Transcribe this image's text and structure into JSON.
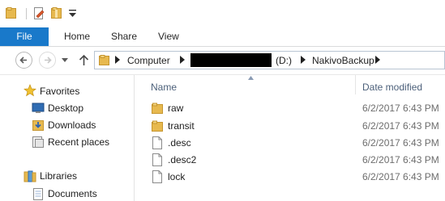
{
  "ribbon": {
    "tabs": [
      "File",
      "Home",
      "Share",
      "View"
    ]
  },
  "quick_access": {
    "icons": [
      "folder-icon",
      "properties-icon",
      "new-folder-icon",
      "customize-dropdown-icon"
    ]
  },
  "address_bar": {
    "segments": [
      "Computer",
      "(D:)",
      "NakivoBackup"
    ],
    "redacted": true
  },
  "nav_pane": {
    "favorites_label": "Favorites",
    "favorites": [
      "Desktop",
      "Downloads",
      "Recent places"
    ],
    "libraries_label": "Libraries",
    "libraries": [
      "Documents"
    ]
  },
  "file_list": {
    "columns": {
      "name": "Name",
      "date_modified": "Date modified"
    },
    "sort_column": "Name",
    "rows": [
      {
        "name": "raw",
        "type": "folder",
        "date": "6/2/2017 6:43 PM"
      },
      {
        "name": "transit",
        "type": "folder",
        "date": "6/2/2017 6:43 PM"
      },
      {
        "name": ".desc",
        "type": "file",
        "date": "6/2/2017 6:43 PM"
      },
      {
        "name": ".desc2",
        "type": "file",
        "date": "6/2/2017 6:43 PM"
      },
      {
        "name": "lock",
        "type": "file",
        "date": "6/2/2017 6:43 PM"
      }
    ]
  },
  "colors": {
    "file_tab": "#1979ca",
    "folder": "#e7b94f",
    "header_text": "#4c607a"
  }
}
